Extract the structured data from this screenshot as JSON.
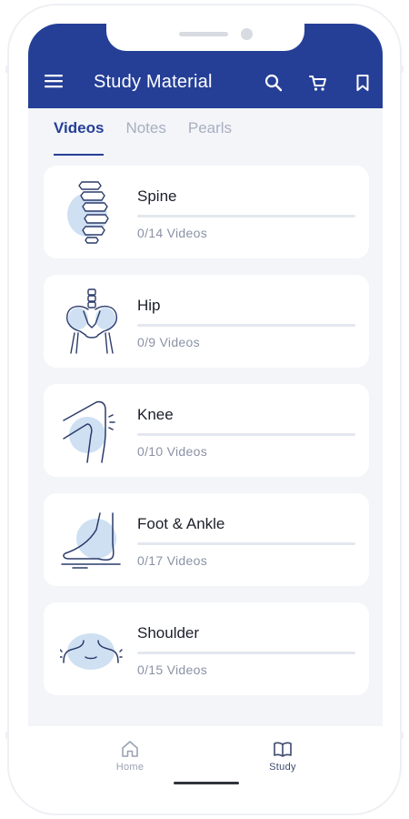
{
  "app_bar": {
    "title": "Study Material",
    "background_color": "#253f97",
    "icons": [
      "menu-icon",
      "search-icon",
      "cart-icon",
      "bookmark-icon"
    ]
  },
  "tabs": [
    {
      "label": "Videos",
      "active": true
    },
    {
      "label": "Notes",
      "active": false
    },
    {
      "label": "Pearls",
      "active": false
    }
  ],
  "topics": [
    {
      "name": "Spine",
      "count": "0/14 Videos",
      "progress": 0,
      "icon": "spine-icon"
    },
    {
      "name": "Hip",
      "count": "0/9 Videos",
      "progress": 0,
      "icon": "hip-icon"
    },
    {
      "name": "Knee",
      "count": "0/10 Videos",
      "progress": 0,
      "icon": "knee-icon"
    },
    {
      "name": "Foot & Ankle",
      "count": "0/17 Videos",
      "progress": 0,
      "icon": "foot-ankle-icon"
    },
    {
      "name": "Shoulder",
      "count": "0/15 Videos",
      "progress": 0,
      "icon": "shoulder-icon"
    }
  ],
  "bottom_nav": [
    {
      "label": "Home",
      "icon": "home-icon",
      "active": false
    },
    {
      "label": "Study",
      "icon": "book-icon",
      "active": true
    }
  ],
  "colors": {
    "accent": "#253f97",
    "illustration_fill": "#cfe0f3",
    "background": "#f3f5f9"
  }
}
